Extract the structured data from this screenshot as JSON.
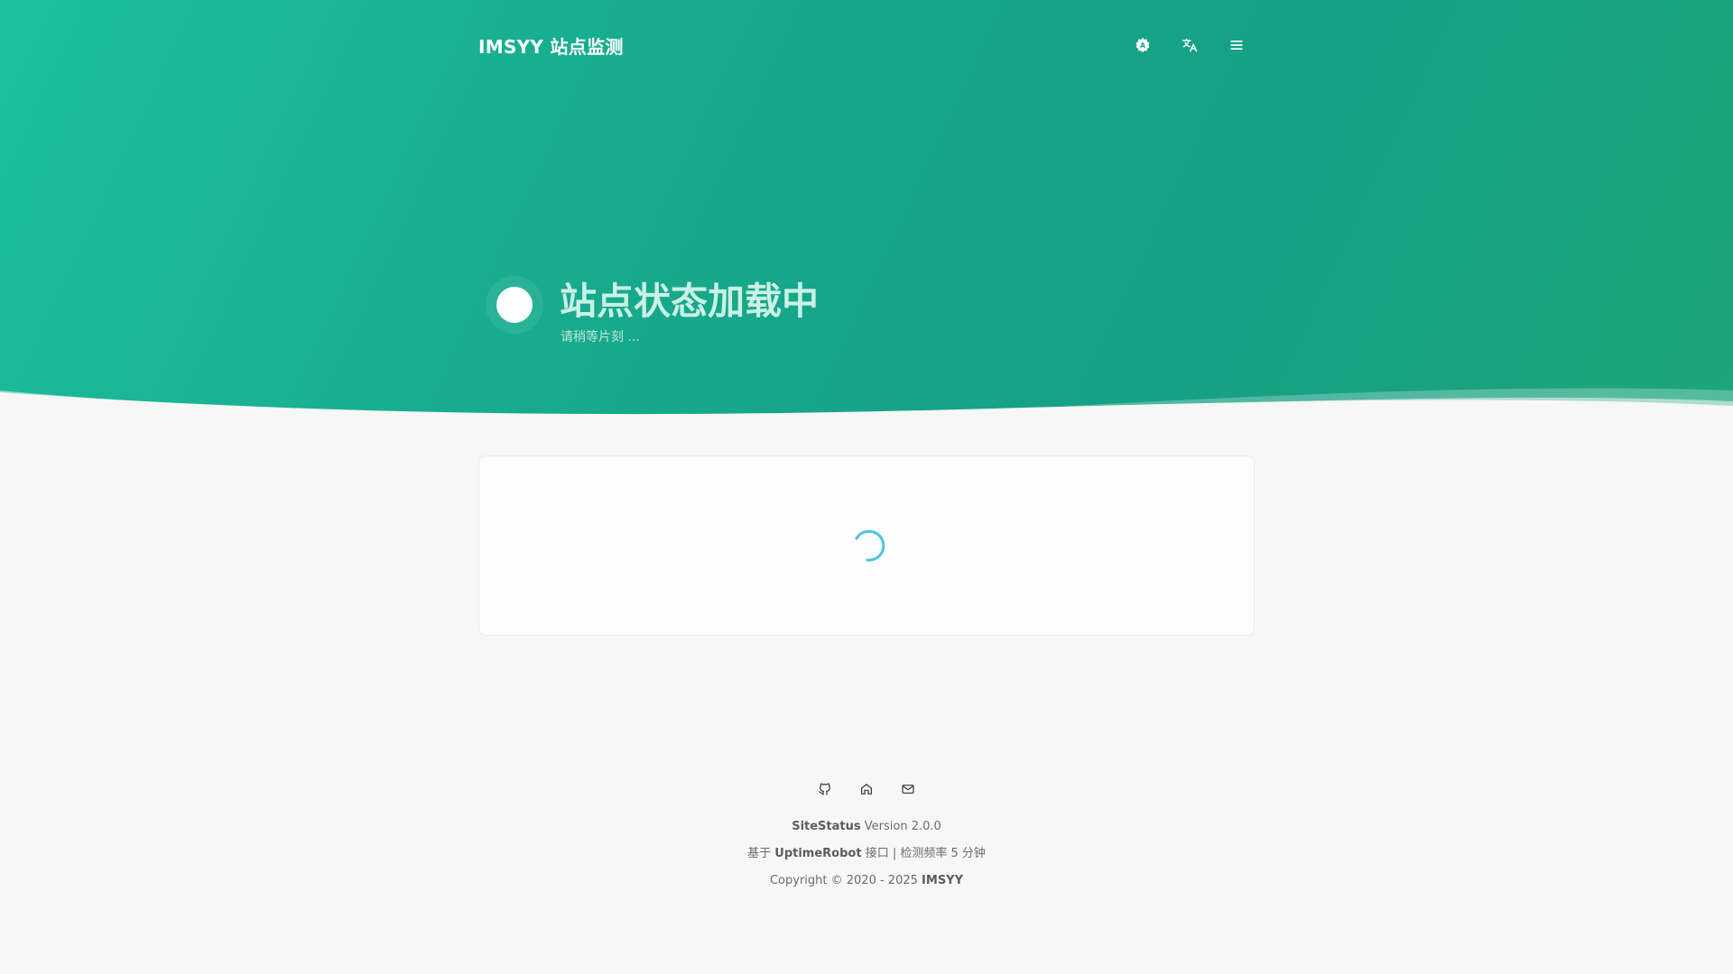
{
  "header": {
    "brand": "IMSYY 站点监测",
    "icons": [
      "theme-icon",
      "translate-icon",
      "menu-icon"
    ]
  },
  "status": {
    "title": "站点状态加载中",
    "subtitle": "请稍等片刻 ..."
  },
  "footer": {
    "icons": [
      "github-icon",
      "home-icon",
      "mail-icon"
    ],
    "app_name": "SiteStatus",
    "version": "Version 2.0.0",
    "line2_prefix": "基于",
    "api_name": "UptimeRobot",
    "line2_suffix": "接口 | 检测频率 5 分钟",
    "copyright_prefix": "Copyright © 2020 - 2025",
    "copyright_owner": "IMSYY"
  },
  "colors": {
    "hero_start": "#1cbf9c",
    "hero_end": "#1ea57c",
    "spinner": "#4fc3e6",
    "background": "#f7f7f7"
  }
}
